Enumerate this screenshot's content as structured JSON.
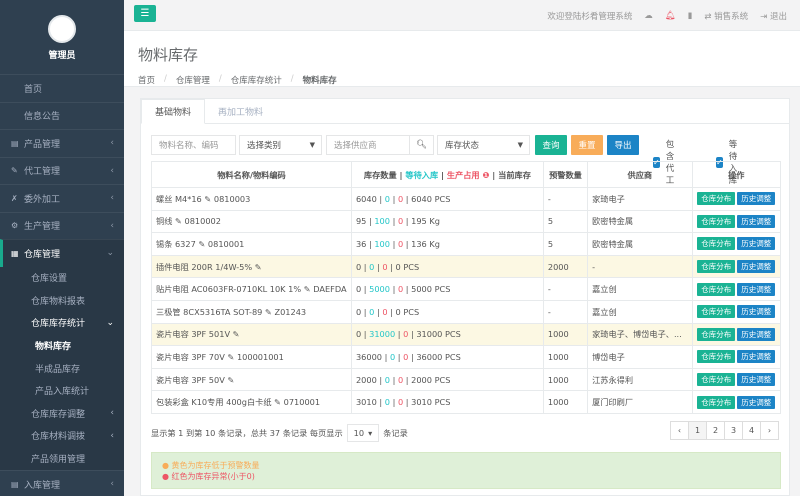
{
  "sidebar": {
    "user": "管理员",
    "items": [
      {
        "label": "首页",
        "icon": "",
        "chev": ""
      },
      {
        "label": "信息公告",
        "icon": "",
        "chev": ""
      },
      {
        "label": "产品管理",
        "icon": "▤",
        "chev": "‹"
      },
      {
        "label": "代工管理",
        "icon": "✎",
        "chev": "‹"
      },
      {
        "label": "委外加工",
        "icon": "✗",
        "chev": "‹"
      },
      {
        "label": "生产管理",
        "icon": "⚙",
        "chev": "‹"
      }
    ],
    "active": {
      "label": "仓库管理",
      "icon": "▦",
      "chev": "⌄"
    },
    "sub": [
      {
        "label": "仓库设置"
      },
      {
        "label": "仓库物料报表"
      }
    ],
    "sub_open": {
      "label": "仓库库存统计",
      "chev": "⌄"
    },
    "sub_sub": [
      {
        "label": "物料库存"
      },
      {
        "label": "半成品库存"
      },
      {
        "label": "产品入库统计"
      }
    ],
    "sub2": [
      {
        "label": "仓库库存调整",
        "chev": "‹"
      },
      {
        "label": "仓库材料调拨",
        "chev": "‹"
      },
      {
        "label": "产品领用管理",
        "chev": ""
      }
    ],
    "bottom": {
      "label": "入库管理",
      "icon": "▤",
      "chev": "‹"
    }
  },
  "topbar": {
    "welcome": "欢迎登陆杉肴管理系统",
    "sales": "⇄ 销售系统",
    "logout": "⇥ 退出"
  },
  "header": {
    "title": "物料库存",
    "breadcrumb": [
      "首页",
      "仓库管理",
      "仓库库存统计",
      "物料库存"
    ]
  },
  "tabs": [
    "基础物料",
    "再加工物料"
  ],
  "filters": {
    "name_placeholder": "物料名称、编码",
    "category": "选择类别",
    "supplier_placeholder": "选择供应商",
    "status": "库存状态",
    "query": "查询",
    "reset": "重置",
    "export": "导出",
    "chk1": "包含代工",
    "chk2": "等待入库"
  },
  "table": {
    "headers": {
      "name": "物料名称/物料编码",
      "stock_a": "库存数量",
      "stock_b": "等待入库",
      "stock_c": "生产占用",
      "stock_d": "当前库存",
      "warn": "预警数量",
      "supplier": "供应商",
      "op": "操作"
    },
    "op_labels": [
      "仓库分布",
      "历史调整"
    ],
    "rows": [
      {
        "name": "螺丝 M4*16",
        "code": "0810003",
        "a": "6040",
        "b": "0",
        "c": "0",
        "d": "6040 PCS",
        "warn": "-",
        "supplier": "家琦电子",
        "hl": false
      },
      {
        "name": "铜线",
        "code": "0810002",
        "a": "95",
        "b": "100",
        "c": "0",
        "d": "195 Kg",
        "warn": "5",
        "supplier": "欧密特金属",
        "hl": false
      },
      {
        "name": "锡条 6327",
        "code": "0810001",
        "a": "36",
        "b": "100",
        "c": "0",
        "d": "136 Kg",
        "warn": "5",
        "supplier": "欧密特金属",
        "hl": false
      },
      {
        "name": "插件电阻 200R 1/4W-5%",
        "code": "",
        "a": "0",
        "b": "0",
        "c": "0",
        "d": "0 PCS",
        "warn": "2000",
        "supplier": "-",
        "hl": true
      },
      {
        "name": "贴片电阻 AC0603FR-0710KL 10K 1%",
        "code": "DAEFDA",
        "a": "0",
        "b": "5000",
        "c": "0",
        "d": "5000 PCS",
        "warn": "-",
        "supplier": "嘉立创",
        "hl": false
      },
      {
        "name": "三极管 8CX5316TA SOT-89",
        "code": "Z01243",
        "a": "0",
        "b": "0",
        "c": "0",
        "d": "0 PCS",
        "warn": "-",
        "supplier": "嘉立创",
        "hl": false
      },
      {
        "name": "瓷片电容 3PF 501V",
        "code": "",
        "a": "0",
        "b": "31000",
        "c": "0",
        "d": "31000 PCS",
        "warn": "1000",
        "supplier": "家琦电子、博岱电子、...",
        "hl": true
      },
      {
        "name": "瓷片电容 3PF 70V",
        "code": "100001001",
        "a": "36000",
        "b": "0",
        "c": "0",
        "d": "36000 PCS",
        "warn": "1000",
        "supplier": "博岱电子",
        "hl": false
      },
      {
        "name": "瓷片电容 3PF 50V",
        "code": "",
        "a": "2000",
        "b": "0",
        "c": "0",
        "d": "2000 PCS",
        "warn": "1000",
        "supplier": "江苏永得利",
        "hl": false
      },
      {
        "name": "包装彩盒 K10专用 400g白卡纸",
        "code": "0710001",
        "a": "3010",
        "b": "0",
        "c": "0",
        "d": "3010 PCS",
        "warn": "1000",
        "supplier": "厦门印刷厂",
        "hl": false
      }
    ]
  },
  "pager": {
    "text_a": "显示第 1 到第 10 条记录，总共 37 条记录 每页显示",
    "size": "10",
    "text_b": "条记录",
    "pages": [
      "‹",
      "1",
      "2",
      "3",
      "4",
      "›"
    ]
  },
  "alert": {
    "line1": "黄色为库存低于预警数量",
    "line2": "红色为库存异常(小于0)"
  }
}
